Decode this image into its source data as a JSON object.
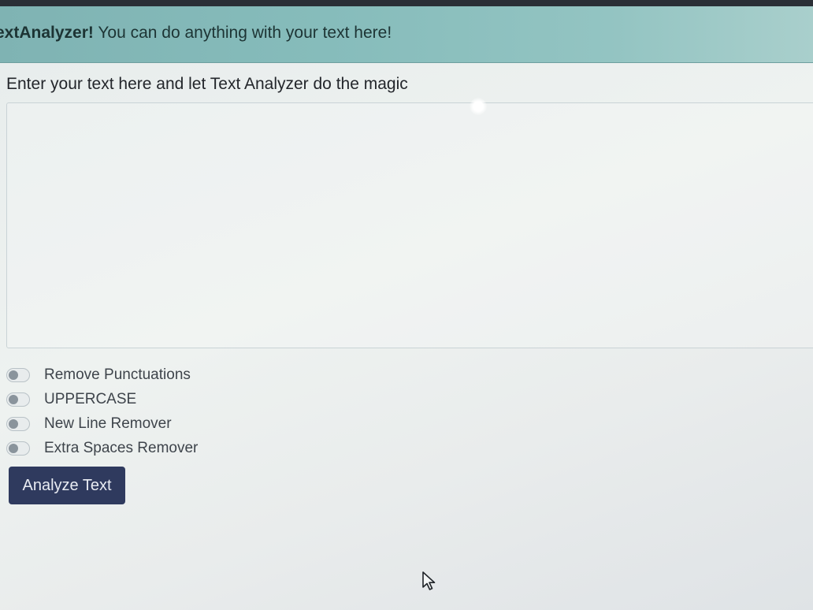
{
  "banner": {
    "strong_text": "extAnalyzer!",
    "message": " You can do anything with your text here!",
    "color": "#86bcbb"
  },
  "form": {
    "label": "Enter your text here and let Text Analyzer do the magic",
    "textarea_value": ""
  },
  "options": [
    {
      "label": "Remove Punctuations"
    },
    {
      "label": "UPPERCASE"
    },
    {
      "label": "New Line Remover"
    },
    {
      "label": "Extra Spaces Remover"
    }
  ],
  "actions": {
    "analyze_label": "Analyze Text",
    "button_color": "#2f3a5e"
  },
  "icons": {
    "cursor": "mouse-pointer-icon"
  }
}
